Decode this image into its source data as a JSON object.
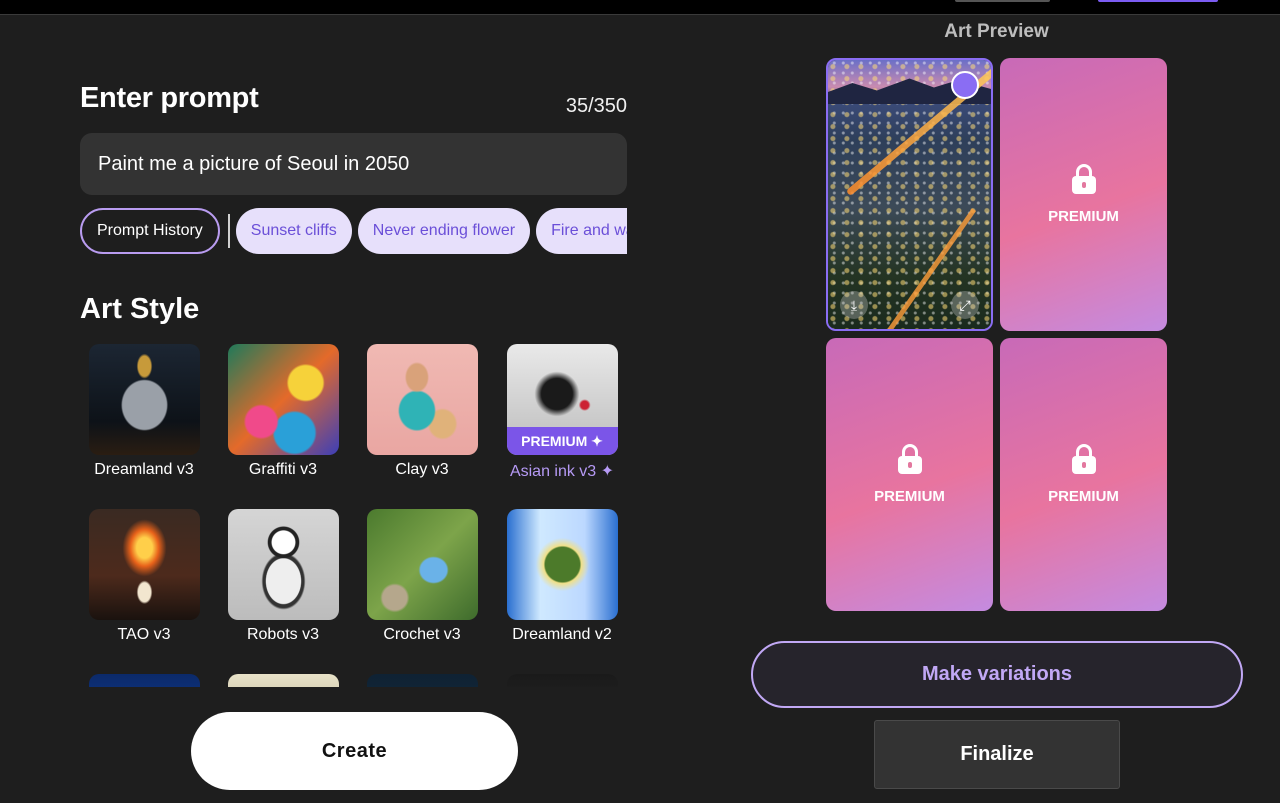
{
  "prompt": {
    "title": "Enter prompt",
    "count": "35/350",
    "value": "Paint me a picture of Seoul in 2050"
  },
  "chips": {
    "history_label": "Prompt History",
    "suggestions": [
      "Sunset cliffs",
      "Never ending flower",
      "Fire and wa"
    ]
  },
  "art_style": {
    "title": "Art Style",
    "items": [
      {
        "label": "Dreamland v3",
        "premium": false
      },
      {
        "label": "Graffiti v3",
        "premium": false
      },
      {
        "label": "Clay v3",
        "premium": false
      },
      {
        "label": "Asian ink v3 ✦",
        "premium": true,
        "tag": "PREMIUM ✦"
      },
      {
        "label": "TAO v3",
        "premium": false
      },
      {
        "label": "Robots v3",
        "premium": false
      },
      {
        "label": "Crochet v3",
        "premium": false
      },
      {
        "label": "Dreamland v2",
        "premium": false
      }
    ]
  },
  "create_label": "Create",
  "preview": {
    "title": "Art Preview",
    "premium_label": "PREMIUM",
    "download_icon": "⤓",
    "expand_icon": "⤢"
  },
  "actions": {
    "variations_label": "Make variations",
    "finalize_label": "Finalize"
  },
  "colors": {
    "accent": "#8a6df3",
    "chip_bg": "#e7e0fb",
    "premium_gradient": [
      "#c86ab8",
      "#e8749f",
      "#c48be0"
    ]
  }
}
